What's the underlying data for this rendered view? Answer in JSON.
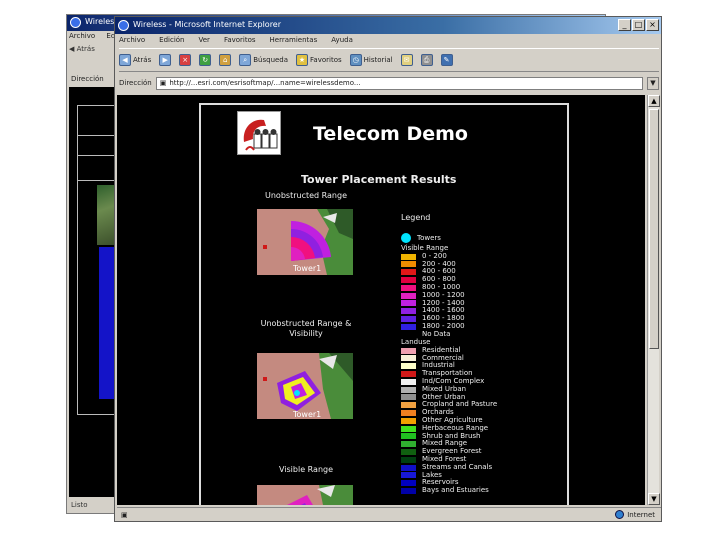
{
  "back_window": {
    "title": "Wireless",
    "menu": [
      "Archivo",
      "Edic"
    ],
    "toolbar_back": "Atrás",
    "address_label": "Dirección",
    "status": "Listo"
  },
  "main_window": {
    "title": "Wireless - Microsoft Internet Explorer",
    "controls": {
      "minimize": "_",
      "maximize": "□",
      "close": "×"
    },
    "menu": [
      "Archivo",
      "Edición",
      "Ver",
      "Favoritos",
      "Herramientas",
      "Ayuda"
    ],
    "toolbar": [
      {
        "icon": "back-arrow-icon",
        "label": "Atrás"
      },
      {
        "icon": "forward-arrow-icon",
        "label": ""
      },
      {
        "icon": "stop-icon",
        "label": ""
      },
      {
        "icon": "refresh-icon",
        "label": ""
      },
      {
        "icon": "home-icon",
        "label": ""
      },
      {
        "icon": "search-icon",
        "label": "Búsqueda"
      },
      {
        "icon": "favorites-icon",
        "label": "Favoritos"
      },
      {
        "icon": "history-icon",
        "label": "Historial"
      },
      {
        "icon": "mail-icon",
        "label": ""
      },
      {
        "icon": "print-icon",
        "label": ""
      },
      {
        "icon": "edit-icon",
        "label": ""
      }
    ],
    "address_label": "Dirección",
    "address_value": "http://...esri.com/esrisoftmap/...name=wirelessdemo...",
    "status_text": "",
    "status_zone": "Internet"
  },
  "page": {
    "title": "Telecom Demo",
    "results_heading": "Tower Placement Results",
    "maps": [
      {
        "label": "Unobstructed Range",
        "overlay": "range"
      },
      {
        "label": "Unobstructed Range & Visibility",
        "overlay": "visibility"
      },
      {
        "label": "Visible Range",
        "overlay": "visible"
      }
    ],
    "tower_tag": "Tower1",
    "legend": {
      "title": "Legend",
      "towers_label": "Towers",
      "visible_range_heading": "Visible Range",
      "visible_range": [
        {
          "label": "0 - 200",
          "color": "#f0b400"
        },
        {
          "label": "200 - 400",
          "color": "#f08c00"
        },
        {
          "label": "400 - 600",
          "color": "#e01818"
        },
        {
          "label": "600 - 800",
          "color": "#e00040"
        },
        {
          "label": "800 - 1000",
          "color": "#f01080"
        },
        {
          "label": "1000 - 1200",
          "color": "#e020c0"
        },
        {
          "label": "1200 - 1400",
          "color": "#c020e0"
        },
        {
          "label": "1400 - 1600",
          "color": "#9020e0"
        },
        {
          "label": "1600 - 1800",
          "color": "#6020e0"
        },
        {
          "label": "1800 - 2000",
          "color": "#3020e0"
        },
        {
          "label": "No Data",
          "color": "#000000"
        }
      ],
      "landuse_heading": "Landuse",
      "landuse": [
        {
          "label": "Residential",
          "color": "#f0a0b0"
        },
        {
          "label": "Commercial",
          "color": "#f8f0d8"
        },
        {
          "label": "Industrial",
          "color": "#ffffc8"
        },
        {
          "label": "Transportation",
          "color": "#d01818"
        },
        {
          "label": "Ind/Com Complex",
          "color": "#f0f0f0"
        },
        {
          "label": "Mixed Urban",
          "color": "#b0b0b0"
        },
        {
          "label": "Other Urban",
          "color": "#909090"
        },
        {
          "label": "Cropland and Pasture",
          "color": "#f0a040"
        },
        {
          "label": "Orchards",
          "color": "#f08020"
        },
        {
          "label": "Other Agriculture",
          "color": "#f0a000"
        },
        {
          "label": "Herbaceous Range",
          "color": "#40e020"
        },
        {
          "label": "Shrub and Brush",
          "color": "#20c020"
        },
        {
          "label": "Mixed Range",
          "color": "#30b030"
        },
        {
          "label": "Evergreen Forest",
          "color": "#106010"
        },
        {
          "label": "Mixed Forest",
          "color": "#004010"
        },
        {
          "label": "Streams and Canals",
          "color": "#1010c8"
        },
        {
          "label": "Lakes",
          "color": "#1818d8"
        },
        {
          "label": "Reservoirs",
          "color": "#0000c0"
        },
        {
          "label": "Bays and Estuaries",
          "color": "#0000a8"
        }
      ]
    }
  }
}
